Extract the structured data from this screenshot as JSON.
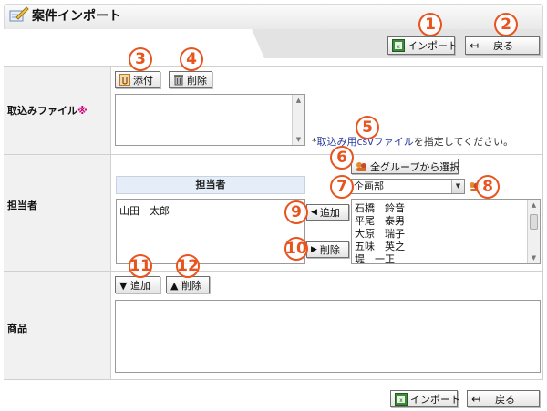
{
  "header": {
    "title": "案件インポート",
    "import_label": "インポート",
    "back_label": "戻る"
  },
  "file_section": {
    "label": "取込みファイル",
    "required_mark": "※",
    "attach_label": "添付",
    "delete_label": "削除",
    "hint_prefix": "*",
    "hint_link": "取込み用csvファイル",
    "hint_suffix": "を指定してください。"
  },
  "assignee_section": {
    "label": "担当者",
    "column_header": "担当者",
    "selected": [
      "山田　太郎"
    ],
    "select_all_groups_label": "全グループから選択",
    "group_value": "企画部",
    "add_label": "追加",
    "delete_label": "削除",
    "candidates": [
      "石橋　鈴音",
      "平尾　泰男",
      "大原　瑞子",
      "五味　英之",
      "堤　一正"
    ]
  },
  "product_section": {
    "label": "商品",
    "add_label": "▼ 追加",
    "delete_label": "▲ 削除"
  },
  "footer": {
    "import_label": "インポート",
    "back_label": "戻る"
  },
  "callouts": [
    "1",
    "2",
    "3",
    "4",
    "5",
    "6",
    "7",
    "8",
    "9",
    "10",
    "11",
    "12"
  ],
  "colors": {
    "callout": "#e8541e",
    "assignee_header_bg": "#e4edf8",
    "label_bg": "#f1f1f1",
    "required": "#d0007a",
    "hint_link": "#2a3f9e"
  }
}
